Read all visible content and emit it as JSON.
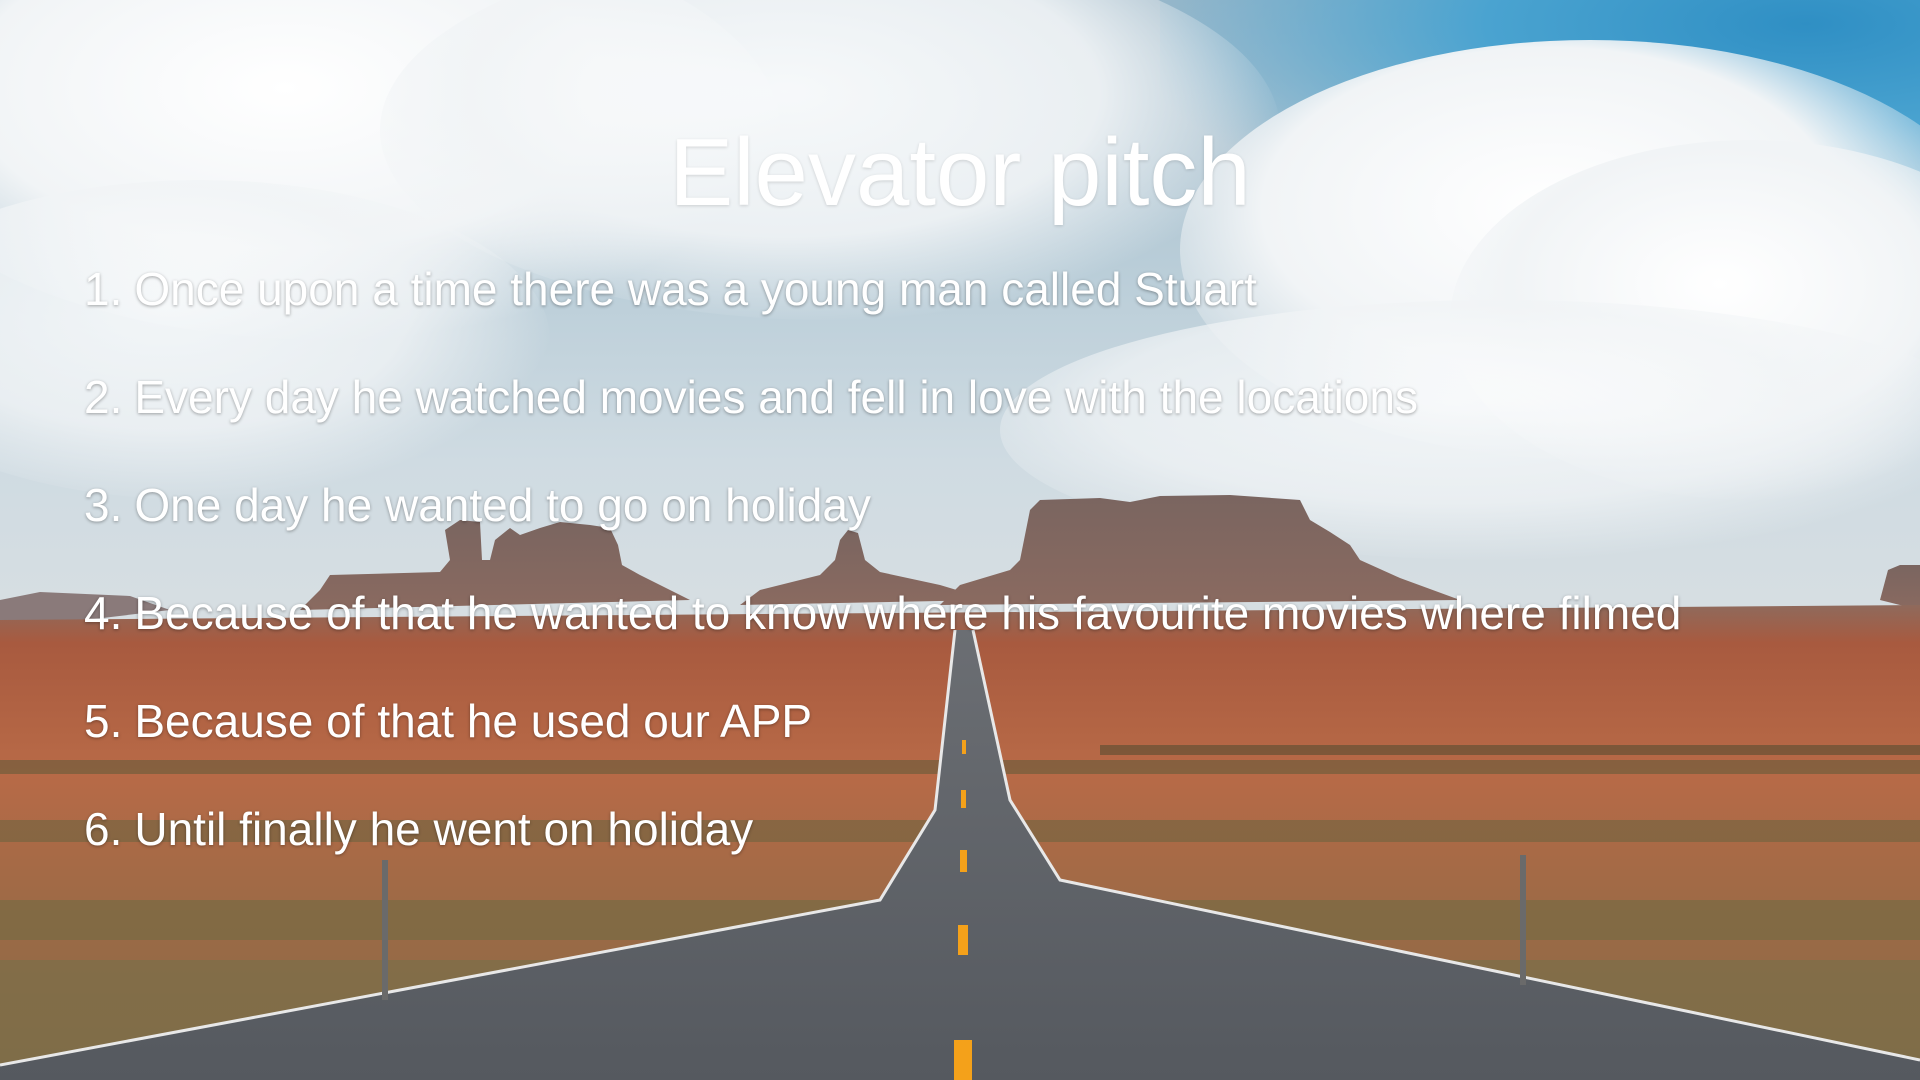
{
  "slide": {
    "title": "Elevator pitch",
    "items": [
      {
        "number": "1.",
        "text": "Once upon a time there was a young man called Stuart"
      },
      {
        "number": "2.",
        "text": "Every day he watched movies and fell in love with the locations"
      },
      {
        "number": "3.",
        "text": "One day he wanted to go on holiday"
      },
      {
        "number": "4.",
        "text": "Because of that he wanted to know where his favourite movies where filmed"
      },
      {
        "number": "5.",
        "text": "Because of that he used our APP"
      },
      {
        "number": "6.",
        "text": "Until finally he went on holiday"
      }
    ],
    "background_image": "desert-highway-with-mesas-photo",
    "colors": {
      "text": "#ffffff",
      "sky_blue": "#3a97c8",
      "desert_red": "#b8583a",
      "road_asphalt": "#5a5f66",
      "center_line": "#f4a11a"
    }
  }
}
